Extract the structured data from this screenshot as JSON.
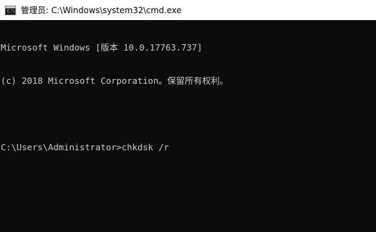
{
  "window": {
    "title": "管理员: C:\\Windows\\system32\\cmd.exe",
    "icon": "cmd-icon",
    "icon_prompt": "C:\\",
    "background": "#0c0c0c",
    "text_color": "#cccccc"
  },
  "console": {
    "lines": [
      "Microsoft Windows [版本 10.0.17763.737]",
      "(c) 2018 Microsoft Corporation。保留所有权利。",
      "",
      "C:\\Users\\Administrator>chkdsk /r"
    ],
    "prompt": "C:\\Users\\Administrator>",
    "command": "chkdsk /r"
  }
}
